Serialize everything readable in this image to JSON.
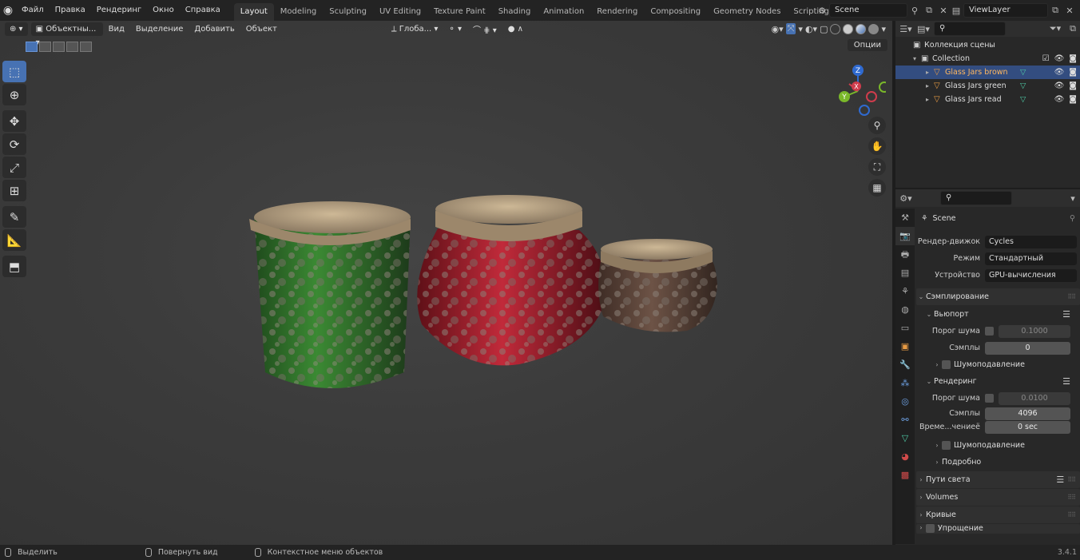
{
  "topbar": {
    "menu": [
      "Файл",
      "Правка",
      "Рендеринг",
      "Окно",
      "Справка"
    ],
    "workspaces": [
      "Layout",
      "Modeling",
      "Sculpting",
      "UV Editing",
      "Texture Paint",
      "Shading",
      "Animation",
      "Rendering",
      "Compositing",
      "Geometry Nodes",
      "Scripting"
    ],
    "active_workspace": "Layout",
    "scene": "Scene",
    "view_layer": "ViewLayer"
  },
  "viewport": {
    "mode": "Объектны...",
    "menus": [
      "Вид",
      "Выделение",
      "Добавить",
      "Объект"
    ],
    "transform_orientation": "Глоба...",
    "options": "Опции",
    "gizmo_axes": {
      "x": "X",
      "y": "Y",
      "z": "Z"
    },
    "tools": [
      "select-box-icon",
      "cursor-icon",
      "move-icon",
      "rotate-icon",
      "scale-icon",
      "transform-icon",
      "annotate-icon",
      "measure-icon",
      "add-cube-icon"
    ],
    "nav": [
      "zoom-icon",
      "hand-icon",
      "camera-icon",
      "grid-icon"
    ],
    "jars": [
      {
        "name": "green",
        "body": "#2f7a2a",
        "lid": "#b29a7c"
      },
      {
        "name": "red",
        "body": "#b01e2e",
        "lid": "#c7b08e"
      },
      {
        "name": "brown",
        "body": "#6b4a3a",
        "lid": "#b29a7c"
      }
    ]
  },
  "outliner": {
    "root": "Коллекция сцены",
    "collection": "Collection",
    "objects": [
      {
        "name": "Glass Jars brown",
        "selected": true
      },
      {
        "name": "Glass Jars green",
        "selected": false
      },
      {
        "name": "Glass Jars read",
        "selected": false
      }
    ]
  },
  "properties": {
    "title": "Scene",
    "render_engine_label": "Рендер-движок",
    "render_engine": "Cycles",
    "mode_label": "Режим",
    "mode": "Стандартный",
    "device_label": "Устройство",
    "device": "GPU-вычисления",
    "sampling": "Сэмплирование",
    "viewport": "Вьюпорт",
    "noise_threshold_label": "Порог шума",
    "viewport_threshold": "0.1000",
    "samples_label": "Сэмплы",
    "viewport_samples": "0",
    "denoise": "Шумоподавление",
    "render": "Рендеринг",
    "render_threshold": "0.0100",
    "render_samples": "4096",
    "time_limit_label": "Време...чениеё",
    "time_limit": "0 sec",
    "advanced": "Подробно",
    "panels": [
      "Пути света",
      "Volumes",
      "Кривые",
      "Упрощение"
    ]
  },
  "statusbar": {
    "select": "Выделить",
    "rotate": "Повернуть вид",
    "context": "Контекстное меню объектов",
    "version": "3.4.1"
  }
}
